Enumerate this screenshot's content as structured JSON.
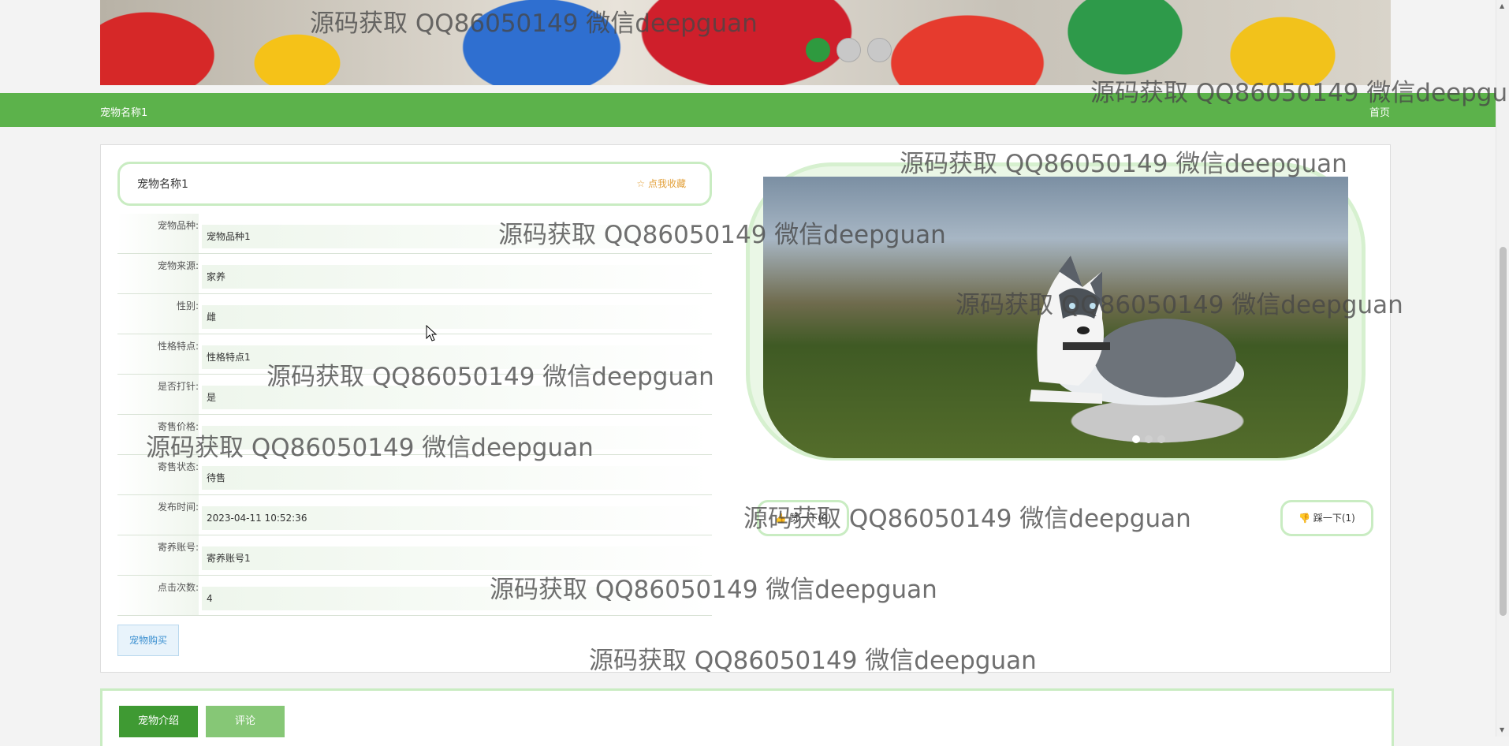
{
  "banner": {
    "slides": 3,
    "active_slide": 1
  },
  "nav": {
    "title": "宠物名称1",
    "home": "首页"
  },
  "detail": {
    "title": "宠物名称1",
    "favorite_label": "☆ 点我收藏",
    "fields": [
      {
        "label": "宠物品种:",
        "value": "宠物品种1"
      },
      {
        "label": "宠物来源:",
        "value": "家养"
      },
      {
        "label": "性别:",
        "value": "雌"
      },
      {
        "label": "性格特点:",
        "value": "性格特点1"
      },
      {
        "label": "是否打针:",
        "value": "是"
      },
      {
        "label": "寄售价格:",
        "value": ""
      },
      {
        "label": "寄售状态:",
        "value": "待售"
      },
      {
        "label": "发布时间:",
        "value": "2023-04-11 10:52:36"
      },
      {
        "label": "寄养账号:",
        "value": "寄养账号1"
      },
      {
        "label": "点击次数:",
        "value": "4"
      }
    ],
    "buy_label": "宠物购买"
  },
  "carousel": {
    "slides": 3,
    "active_slide": 1
  },
  "actions": {
    "prev_label": "👍 赞一下(0)",
    "dislike_label": "👎 踩一下(1)"
  },
  "tabs": [
    {
      "label": "宠物介绍"
    },
    {
      "label": "评论"
    }
  ],
  "watermark": "源码获取 QQ86050149 微信deepguan",
  "colors": {
    "brand_green": "#5cb24b",
    "tab_active": "#3f9a33",
    "tab_inactive": "#86c776",
    "favorite": "#e3a13b"
  }
}
